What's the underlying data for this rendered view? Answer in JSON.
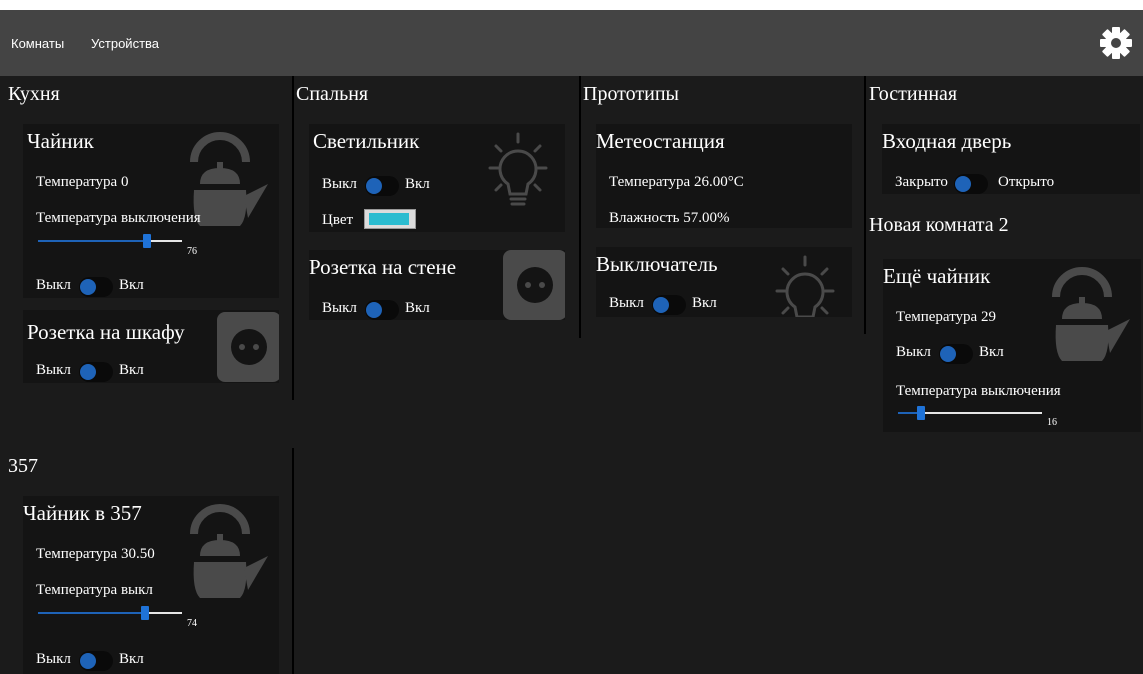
{
  "nav": {
    "rooms": "Комнаты",
    "devices": "Устройства"
  },
  "colors": {
    "accent": "#1e63b8",
    "icon": "#4a4a4a",
    "lamp_color": "#2bbcd0"
  },
  "kitchen": {
    "title": "Кухня",
    "kettle": {
      "title": "Чайник",
      "temperature": "Температура 0",
      "off_temp_label": "Температура выключения",
      "slider_value": "76",
      "slider_fraction": 0.76,
      "off": "Выкл",
      "on": "Вкл",
      "icon": "kettle-icon"
    },
    "socket": {
      "title": "Розетка на шкафу",
      "off": "Выкл",
      "on": "Вкл",
      "icon": "socket-icon"
    }
  },
  "bedroom": {
    "title": "Спальня",
    "lamp": {
      "title": "Светильник",
      "off": "Выкл",
      "on": "Вкл",
      "color_label": "Цвет",
      "icon": "lightbulb-icon"
    },
    "socket": {
      "title": "Розетка на стене",
      "off": "Выкл",
      "on": "Вкл",
      "icon": "socket-icon"
    }
  },
  "prototypes": {
    "title": "Прототипы",
    "weather": {
      "title": "Метеостанция",
      "temperature": "Температура 26.00°C",
      "humidity": "Влажность 57.00%"
    },
    "switch": {
      "title": "Выключатель",
      "off": "Выкл",
      "on": "Вкл",
      "icon": "lightbulb-icon"
    }
  },
  "living": {
    "title": "Гостинная",
    "door": {
      "title": "Входная дверь",
      "closed": "Закрыто",
      "open": "Открыто"
    }
  },
  "newroom": {
    "title": "Новая комната 2",
    "kettle": {
      "title": "Ещё чайник",
      "temperature": "Температура 29",
      "off": "Выкл",
      "on": "Вкл",
      "off_temp_label": "Температура выключения",
      "slider_value": "16",
      "slider_fraction": 0.16,
      "icon": "kettle-icon"
    }
  },
  "room357": {
    "title": "357",
    "kettle": {
      "title": "Чайник в 357",
      "temperature": "Температура 30.50",
      "off_temp_label": "Температура выкл",
      "slider_value": "74",
      "slider_fraction": 0.74,
      "off": "Выкл",
      "on": "Вкл",
      "icon": "kettle-icon"
    }
  }
}
